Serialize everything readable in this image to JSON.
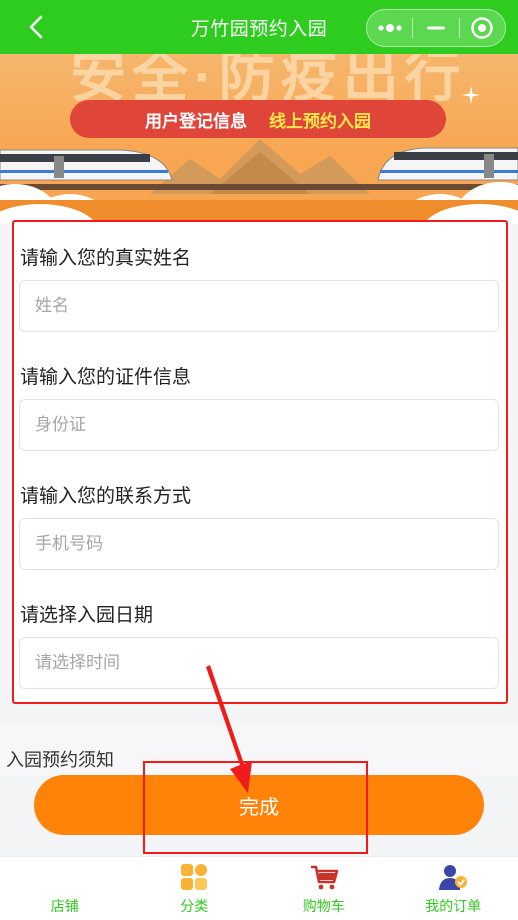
{
  "header": {
    "title": "万竹园预约入园"
  },
  "banner": {
    "big_text": "安全·防疫出行",
    "pill_left": "用户登记信息",
    "pill_right": "线上预约入园"
  },
  "form": {
    "fields": [
      {
        "label": "请输入您的真实姓名",
        "placeholder": "姓名",
        "value": ""
      },
      {
        "label": "请输入您的证件信息",
        "placeholder": "身份证",
        "value": ""
      },
      {
        "label": "请输入您的联系方式",
        "placeholder": "手机号码",
        "value": ""
      },
      {
        "label": "请选择入园日期",
        "placeholder": "请选择时间",
        "value": ""
      }
    ]
  },
  "notice": {
    "text": "入园预约须知"
  },
  "actions": {
    "done_label": "完成"
  },
  "tabbar": {
    "items": [
      {
        "label": "店铺",
        "icon": "shop-icon"
      },
      {
        "label": "分类",
        "icon": "category-icon"
      },
      {
        "label": "购物车",
        "icon": "cart-icon"
      },
      {
        "label": "我的订单",
        "icon": "orders-icon"
      }
    ]
  },
  "colors": {
    "brand_green": "#2ecc1f",
    "accent_orange": "#ff8308",
    "annotation_red": "#ee1c1c"
  }
}
